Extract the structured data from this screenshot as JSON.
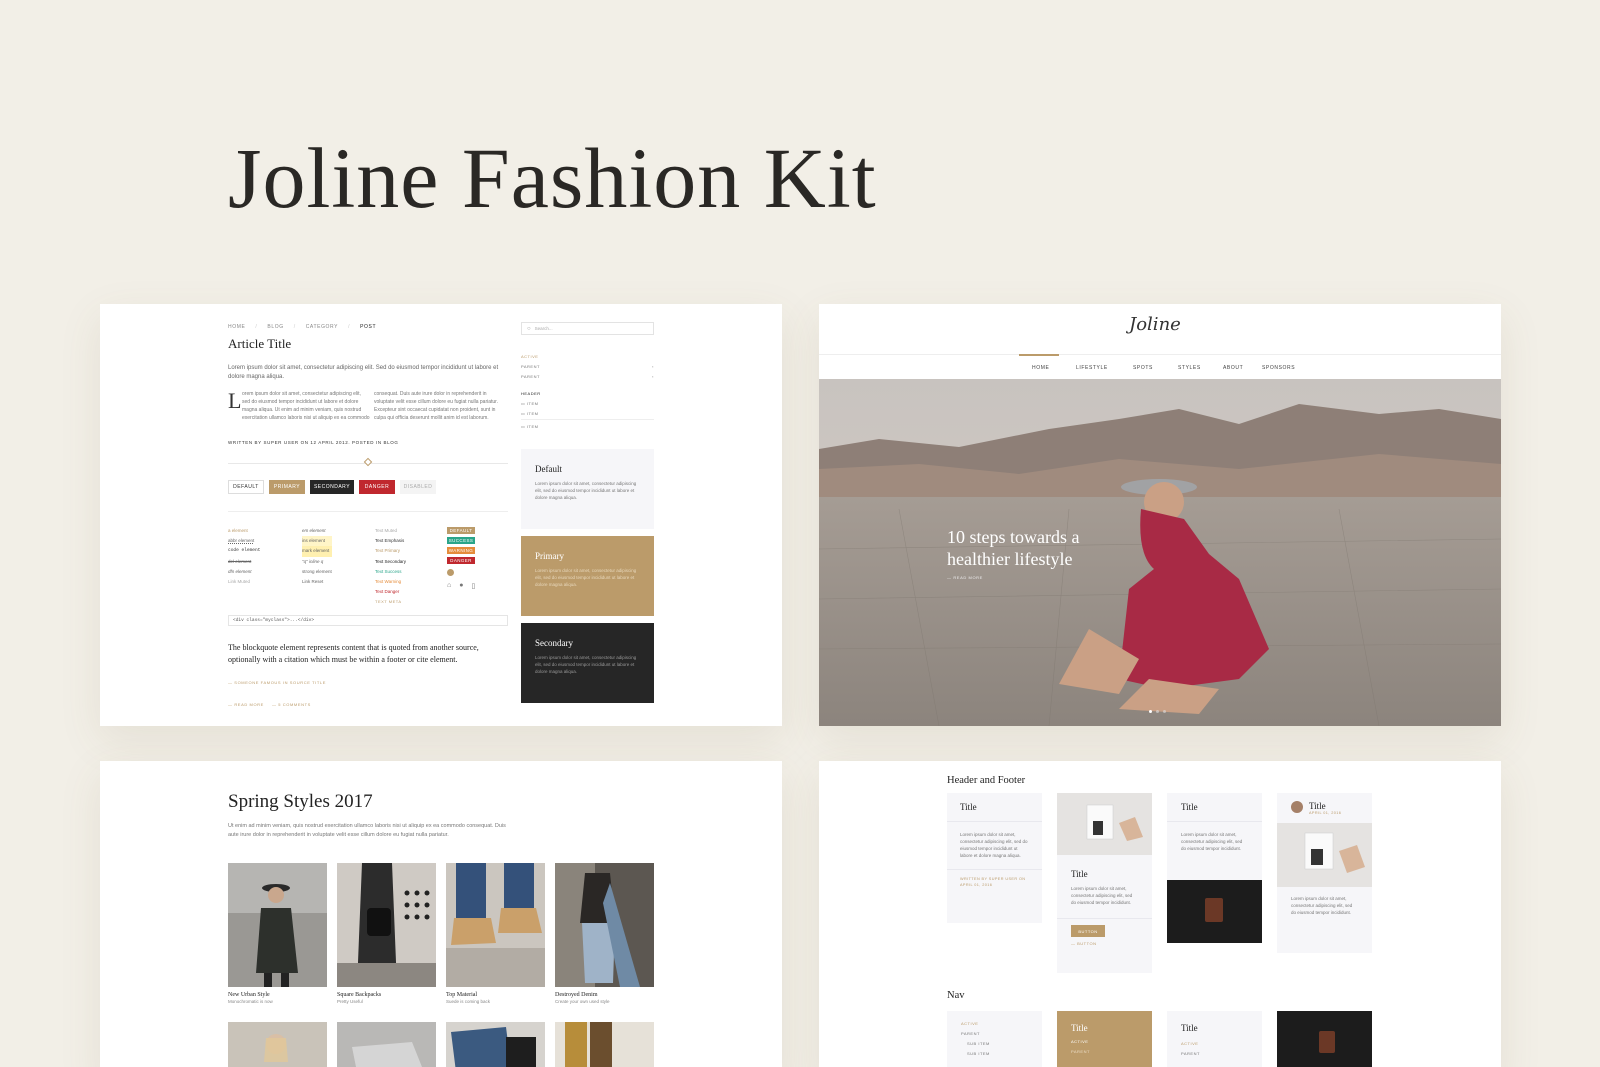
{
  "page_title": "Joline Fashion Kit",
  "article": {
    "breadcrumb": [
      "HOME",
      "BLOG",
      "CATEGORY",
      "POST"
    ],
    "title": "Article Title",
    "intro": "Lorem ipsum dolor sit amet, consectetur adipiscing elit. Sed do eiusmod tempor incididunt ut labore et dolore magna aliqua.",
    "dropcap": "L",
    "col1": "orem ipsum dolor sit amet, consectetur adipiscing elit, sed do eiusmod tempor incididunt ut labore et dolore magna aliqua. Ut enim ad minim veniam, quis nostrud exercitation ullamco laboris nisi ut aliquip ex ea commodo",
    "col2": "consequat. Duis aute irure dolor in reprehenderit in voluptate velit esse cillum dolore eu fugiat nulla pariatur. Excepteur sint occaecat cupidatat non proident, sunt in culpa qui officia deserunt mollit anim id est laborum.",
    "meta": "WRITTEN BY SUPER USER ON 12 APRIL 2012. POSTED IN BLOG",
    "buttons": {
      "default": "DEFAULT",
      "primary": "PRIMARY",
      "secondary": "SECONDARY",
      "danger": "DANGER",
      "disabled": "DISABLED"
    },
    "text_col1": [
      "a element",
      "abbr element",
      "code element",
      "del element",
      "dfn element",
      "Link Muted"
    ],
    "text_col2": [
      "em element",
      "ins element",
      "mark element",
      "\"q\" inline q",
      "strong element",
      "Link Reset"
    ],
    "text_col3": [
      "Text Muted",
      "Text Emphasis",
      "Text Primary",
      "Text Secondary",
      "Text Success",
      "Text Warning",
      "Text Danger",
      "TEXT META"
    ],
    "badges": [
      "DEFAULT",
      "SUCCESS",
      "WARNING",
      "DANGER"
    ],
    "code": "<div class=\"myclass\">...</div>",
    "blockquote": "The blockquote element represents content that is quoted from another source, optionally with a citation which must be within a footer or cite element.",
    "cite": "— SOMEONE FAMOUS IN SOURCE TITLE",
    "read_more": "READ MORE",
    "comments": "5 COMMENTS",
    "search_placeholder": "Search...",
    "sidenav": {
      "active": "ACTIVE",
      "parent1": "PARENT",
      "parent2": "PARENT",
      "header": "HEADER",
      "items": [
        "ITEM",
        "ITEM",
        "ITEM"
      ]
    },
    "cards": [
      {
        "title": "Default",
        "text": "Lorem ipsum dolor sit amet, consectetur adipiscing elit, sed do eiusmod tempor incididunt ut labore et dolore magna aliqua."
      },
      {
        "title": "Primary",
        "text": "Lorem ipsum dolor sit amet, consectetur adipiscing elit, sed do eiusmod tempor incididunt ut labore et dolore magna aliqua."
      },
      {
        "title": "Secondary",
        "text": "Lorem ipsum dolor sit amet, consectetur adipiscing elit, sed do eiusmod tempor incididunt ut labore et dolore magna aliqua."
      }
    ]
  },
  "home": {
    "logo": "Joline",
    "nav": [
      "HOME",
      "LIFESTYLE",
      "SPOTS",
      "STYLES",
      "ABOUT",
      "SPONSORS"
    ],
    "hero_title_1": "10 steps towards a",
    "hero_title_2": "healthier lifestyle",
    "hero_link": "READ MORE"
  },
  "gallery": {
    "title": "Spring Styles 2017",
    "intro1": "Ut enim ad minim veniam, quis nostrud exercitation ullamco laboris nisi ut aliquip ex ea commodo consequat. Duis",
    "intro2": "aute irure dolor in reprehenderit in voluptate velit esse cillum dolore eu fugiat nulla pariatur.",
    "items": [
      {
        "title": "New Urban Style",
        "sub": "Monochromatic is now"
      },
      {
        "title": "Square Backpacks",
        "sub": "Pretty Useful"
      },
      {
        "title": "Top Material",
        "sub": "Suede is coming back"
      },
      {
        "title": "Destroyed Denim",
        "sub": "Create your own used style"
      }
    ]
  },
  "components": {
    "section1": "Header and Footer",
    "section2": "Nav",
    "card_title": "Title",
    "card_text": "Lorem ipsum dolor sit amet, consectetur adipiscing elit, sed do eiusmod tempor incididunt ut labore et dolore magna aliqua.",
    "card_text_short": "Lorem ipsum dolor sit amet, consectetur adipiscing elit, sed do eiusmod tempor incididunt.",
    "card_footer": "WRITTEN BY SUPER USER ON APRIL 01, 2016",
    "date": "APRIL 01, 2016",
    "button": "BUTTON",
    "button_link": "BUTTON",
    "nav_active": "ACTIVE",
    "nav_parent": "PARENT",
    "nav_sub": "SUB ITEM"
  },
  "colors": {
    "gold": "#bb9b6a",
    "dark": "#262626",
    "danger": "#c0282e",
    "success": "#2aa58a",
    "warning": "#e58c3b",
    "bg": "#f2efe7"
  }
}
